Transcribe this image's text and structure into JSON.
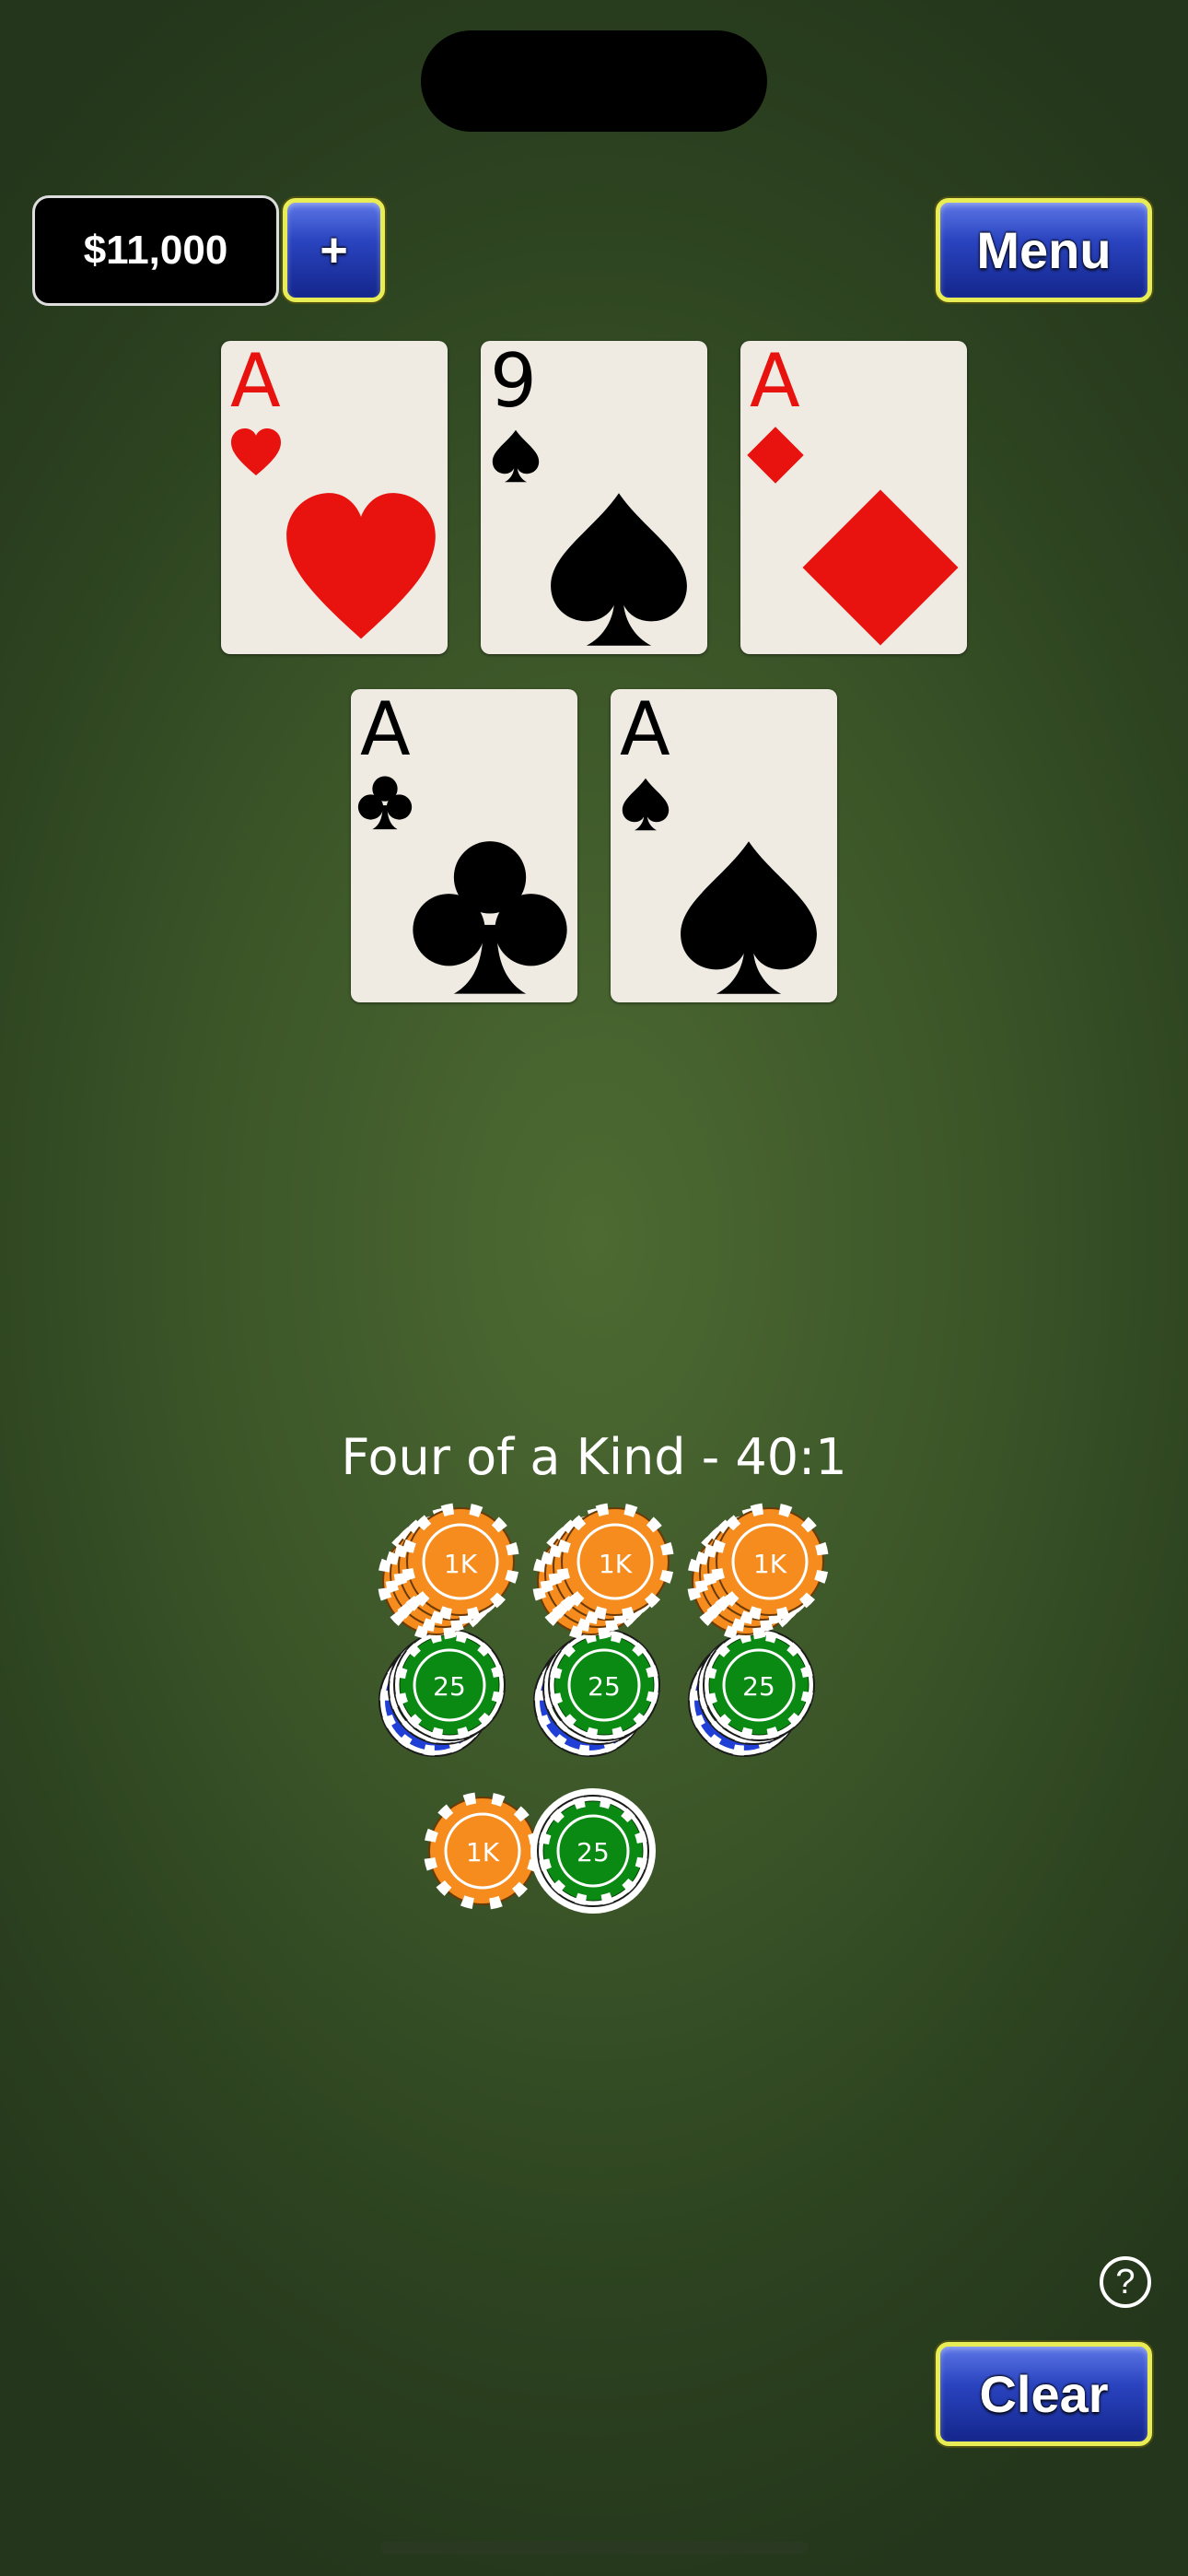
{
  "balance": "$11,000",
  "add_label": "+",
  "menu_label": "Menu",
  "clear_label": "Clear",
  "help_label": "?",
  "result_text": "Four of a Kind - 40:1",
  "colors": {
    "felt": "#4d6a32",
    "button_blue": "#2a44c0",
    "button_border": "#e8ec55",
    "red_suit": "#e8120f",
    "chip_orange": "#f68c1e",
    "chip_green": "#0a8a12",
    "chip_blue": "#1f3fd6"
  },
  "cards": [
    {
      "rank": "A",
      "suit": "heart",
      "color": "red"
    },
    {
      "rank": "9",
      "suit": "spade",
      "color": "black"
    },
    {
      "rank": "A",
      "suit": "diamond",
      "color": "red"
    },
    {
      "rank": "A",
      "suit": "club",
      "color": "black"
    },
    {
      "rank": "A",
      "suit": "spade",
      "color": "black"
    }
  ],
  "chip_labels": {
    "orange": "1K",
    "green": "25"
  }
}
